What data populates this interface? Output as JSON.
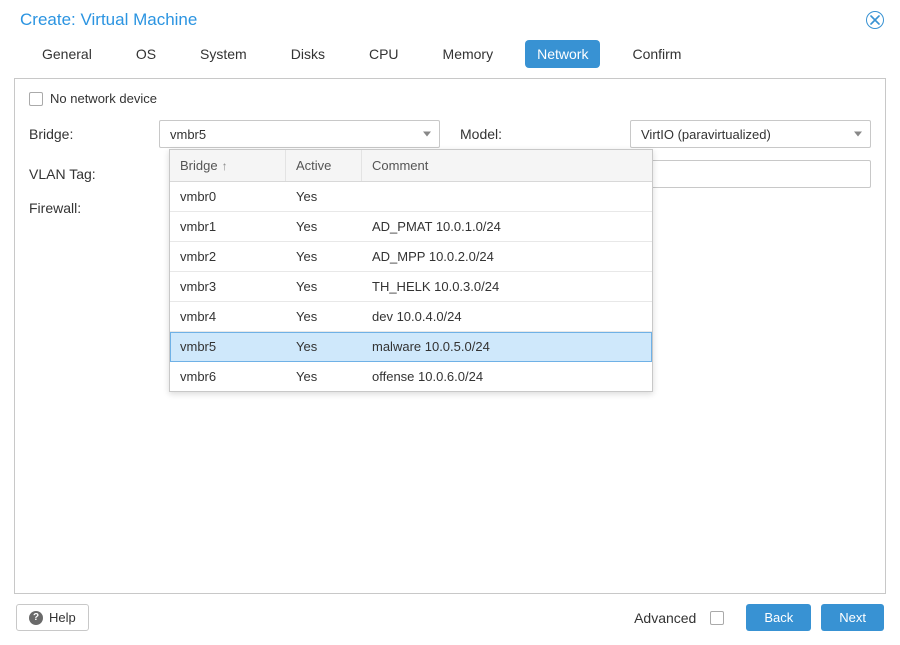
{
  "dialog": {
    "title": "Create: Virtual Machine"
  },
  "tabs": [
    {
      "id": "general",
      "label": "General",
      "active": false
    },
    {
      "id": "os",
      "label": "OS",
      "active": false
    },
    {
      "id": "system",
      "label": "System",
      "active": false
    },
    {
      "id": "disks",
      "label": "Disks",
      "active": false
    },
    {
      "id": "cpu",
      "label": "CPU",
      "active": false
    },
    {
      "id": "memory",
      "label": "Memory",
      "active": false
    },
    {
      "id": "network",
      "label": "Network",
      "active": true
    },
    {
      "id": "confirm",
      "label": "Confirm",
      "active": false
    }
  ],
  "network_form": {
    "no_network_label": "No network device",
    "no_network_checked": false,
    "bridge_label": "Bridge:",
    "bridge_value": "vmbr5",
    "model_label": "Model:",
    "model_value": "VirtIO (paravirtualized)",
    "vlan_label": "VLAN Tag:",
    "vlan_value": "",
    "firewall_label": "Firewall:"
  },
  "bridge_dropdown": {
    "columns": {
      "bridge": "Bridge",
      "active": "Active",
      "comment": "Comment",
      "sort_dir": "asc"
    },
    "rows": [
      {
        "bridge": "vmbr0",
        "active": "Yes",
        "comment": ""
      },
      {
        "bridge": "vmbr1",
        "active": "Yes",
        "comment": "AD_PMAT 10.0.1.0/24"
      },
      {
        "bridge": "vmbr2",
        "active": "Yes",
        "comment": "AD_MPP 10.0.2.0/24"
      },
      {
        "bridge": "vmbr3",
        "active": "Yes",
        "comment": "TH_HELK 10.0.3.0/24"
      },
      {
        "bridge": "vmbr4",
        "active": "Yes",
        "comment": "dev 10.0.4.0/24"
      },
      {
        "bridge": "vmbr5",
        "active": "Yes",
        "comment": "malware 10.0.5.0/24"
      },
      {
        "bridge": "vmbr6",
        "active": "Yes",
        "comment": "offense 10.0.6.0/24"
      }
    ],
    "selected_index": 5
  },
  "footer": {
    "help_label": "Help",
    "advanced_label": "Advanced",
    "advanced_checked": false,
    "back_label": "Back",
    "next_label": "Next"
  }
}
